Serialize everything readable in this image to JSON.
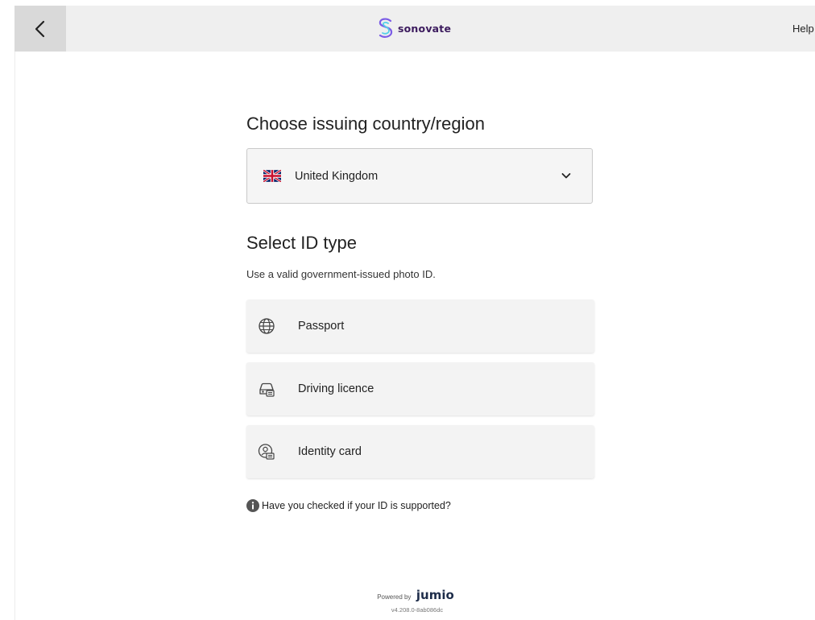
{
  "header": {
    "back_icon": "chevron-left-icon",
    "logo_icon": "sonovate-s-logo-icon",
    "logo_text": "sonovate",
    "logo_color": "#7b5ce6",
    "help_label": "Help"
  },
  "country": {
    "heading": "Choose issuing country/region",
    "selected": "United Kingdom",
    "flag_icon": "uk-flag-icon",
    "dropdown_icon": "chevron-down-icon"
  },
  "id_type": {
    "heading": "Select ID type",
    "subtitle": "Use a valid government-issued photo ID.",
    "options": [
      {
        "label": "Passport",
        "icon": "globe-icon"
      },
      {
        "label": "Driving licence",
        "icon": "car-icon"
      },
      {
        "label": "Identity card",
        "icon": "id-card-icon"
      }
    ]
  },
  "support": {
    "icon": "info-icon",
    "text": "Have you checked if your ID is supported?"
  },
  "footer": {
    "powered_by": "Powered by",
    "brand": "jumio",
    "version": "v4.208.0-8ab086dc"
  }
}
